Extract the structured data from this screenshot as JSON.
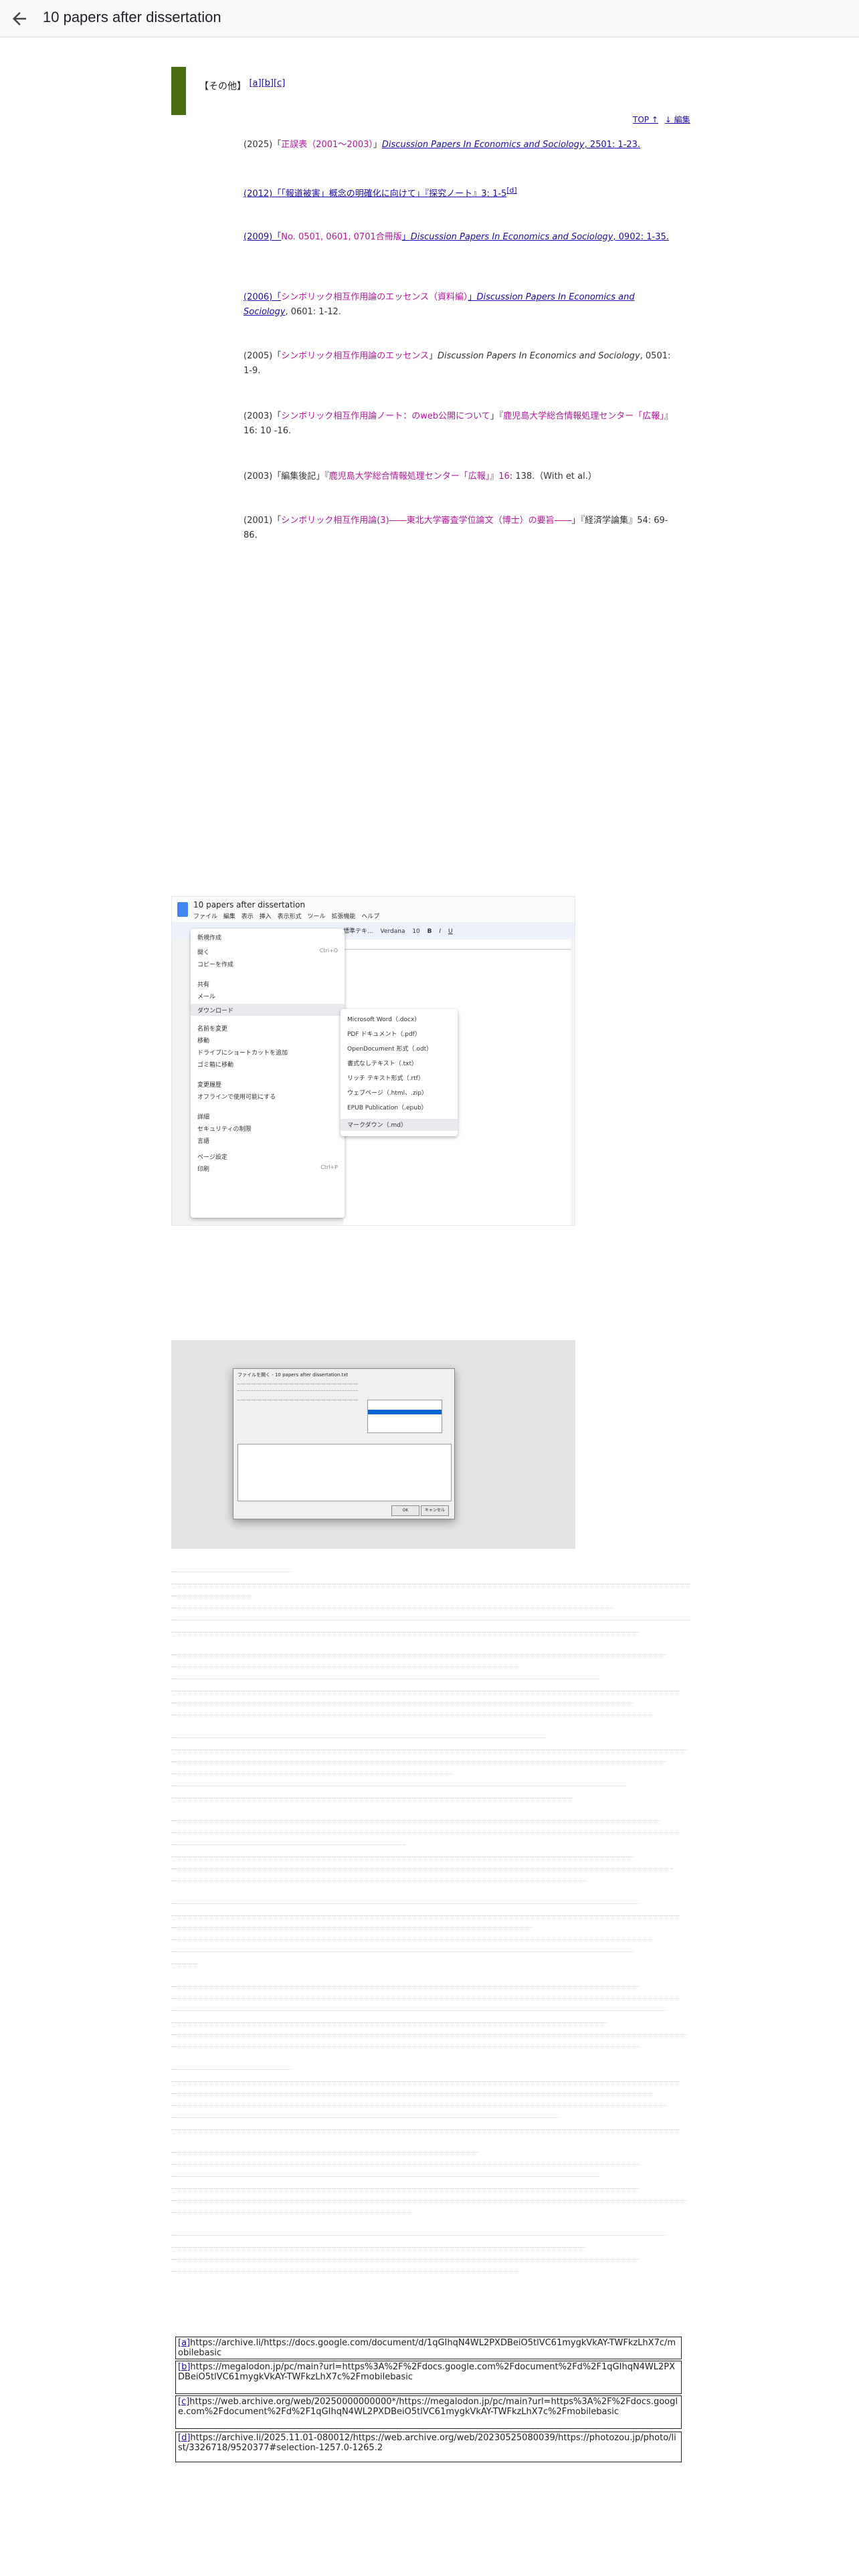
{
  "appbar": {
    "title": "10 papers after dissertation",
    "back_icon": "arrow-left-icon"
  },
  "section": {
    "heading": "【その他】",
    "footnote_markers": [
      "[a]",
      "[b]",
      "[c]"
    ],
    "top_links": [
      "TOP ↑",
      "↓ 編集"
    ]
  },
  "entries": [
    {
      "pre": "(2025)「",
      "title": "正誤表（2001〜2003）",
      "mid": "」",
      "journal": "Discussion Papers In Economics and Sociology",
      "post": ", 2501: 1-23.",
      "ref": ""
    },
    {
      "pre": "(2012)「",
      "title": "「報道被害」概念の明確化に向けて",
      "mid": "」『",
      "journal": "探究ノート",
      "post": "』3: 1-5",
      "ref": "[d]"
    },
    {
      "pre": "(2009)「",
      "title": "No. 0501, 0601, 0701合冊版",
      "mid": "」",
      "journal": "Discussion Papers In Economics and Sociology",
      "post": ", 0902: 1-35.",
      "ref": ""
    },
    {
      "pre": "(2006)「",
      "title": "シンボリック相互作用論のエッセンス（資料編）",
      "mid": "」",
      "journal": "Discussion Papers In Economics and Sociology",
      "post": ", 0601: 1-12.",
      "ref": ""
    },
    {
      "pre": "(2005)「",
      "title": "シンボリック相互作用論のエッセンス",
      "mid": "」",
      "journal": "Discussion Papers In Economics and Sociology",
      "post": ", 0501: 1-9.",
      "ref": ""
    },
    {
      "pre": "(2003)「",
      "title": "シンボリック相互作用論ノート：のweb公開について",
      "mid": "」『",
      "journal": "鹿児島大学総合情報処理センター「広報」",
      "post": "』16: 10 -16.",
      "ref": ""
    },
    {
      "pre": "(2003)「編集後記」『",
      "title": "鹿児島大学総合情報処理センター「広報」",
      "mid": "』",
      "journal": "16",
      "post": ": 138.（With et al.）",
      "ref": ""
    },
    {
      "pre": "(2001)「",
      "title": "シンボリック相互作用論(3)――東北大学審査学位論文（博士）の要旨――",
      "mid": "」『",
      "journal": "経済学論集",
      "post": "』54: 69-86.",
      "ref": ""
    }
  ],
  "screenshot_docs": {
    "doc_title": "10 papers after dissertation",
    "menubar": [
      "ファイル",
      "編集",
      "表示",
      "挿入",
      "表示形式",
      "ツール",
      "拡張機能",
      "ヘルプ"
    ],
    "toolbar": [
      "標準テキ...",
      "Verdana",
      "10",
      "B",
      "I",
      "U"
    ],
    "file_menu": [
      {
        "label": "新規作成",
        "shortcut": ""
      },
      {
        "label": "開く",
        "shortcut": "Ctrl+O"
      },
      {
        "label": "コピーを作成",
        "shortcut": ""
      },
      {
        "label": "共有",
        "shortcut": ""
      },
      {
        "label": "メール",
        "shortcut": ""
      },
      {
        "label": "ダウンロード",
        "shortcut": ""
      },
      {
        "label": "名前を変更",
        "shortcut": ""
      },
      {
        "label": "移動",
        "shortcut": ""
      },
      {
        "label": "ドライブにショートカットを追加",
        "shortcut": ""
      },
      {
        "label": "ゴミ箱に移動",
        "shortcut": ""
      },
      {
        "label": "変更履歴",
        "shortcut": ""
      },
      {
        "label": "オフラインで使用可能にする",
        "shortcut": ""
      },
      {
        "label": "詳細",
        "shortcut": ""
      },
      {
        "label": "セキュリティの制限",
        "shortcut": ""
      },
      {
        "label": "言語",
        "shortcut": ""
      },
      {
        "label": "ページ設定",
        "shortcut": ""
      },
      {
        "label": "印刷",
        "shortcut": "Ctrl+P"
      }
    ],
    "download_submenu": [
      "Microsoft Word（.docx）",
      "PDF ドキュメント（.pdf）",
      "OpenDocument 形式（.odt）",
      "書式なしテキスト（.txt）",
      "リッチ テキスト形式（.rtf）",
      "ウェブページ（.html、.zip）",
      "EPUB Publication（.epub）",
      "マークダウン（.md）"
    ]
  },
  "screenshot_dialog": {
    "title": "ファイルを開く - 10 papers after dissertation.txt",
    "ok_label": "OK",
    "cancel_label": "キャンセル"
  },
  "footnotes": [
    {
      "tag": "[a]",
      "text": "https://archive.li/https://docs.google.com/document/d/1qGIhqN4WL2PXDBeiO5tlVC61mygkVkAY-TWFkzLhX7c/mobilebasic"
    },
    {
      "tag": "[b]",
      "text": "https://megalodon.jp/pc/main?url=https%3A%2F%2Fdocs.google.com%2Fdocument%2Fd%2F1qGIhqN4WL2PXDBeiO5tlVC61mygkVkAY-TWFkzLhX7c%2Fmobilebasic"
    },
    {
      "tag": "[c]",
      "text": "https://web.archive.org/web/20250000000000*/https://megalodon.jp/pc/main?url=https%3A%2F%2Fdocs.google.com%2Fdocument%2Fd%2F1qGIhqN4WL2PXDBeiO5tlVC61mygkVkAY-TWFkzLhX7c%2Fmobilebasic"
    },
    {
      "tag": "[d]",
      "text": "https://archive.li/2025.11.01-080012/https://web.archive.org/web/20230525080039/https://photozou.jp/photo/list/3326718/9520377#selection-1257.0-1265.2"
    }
  ]
}
